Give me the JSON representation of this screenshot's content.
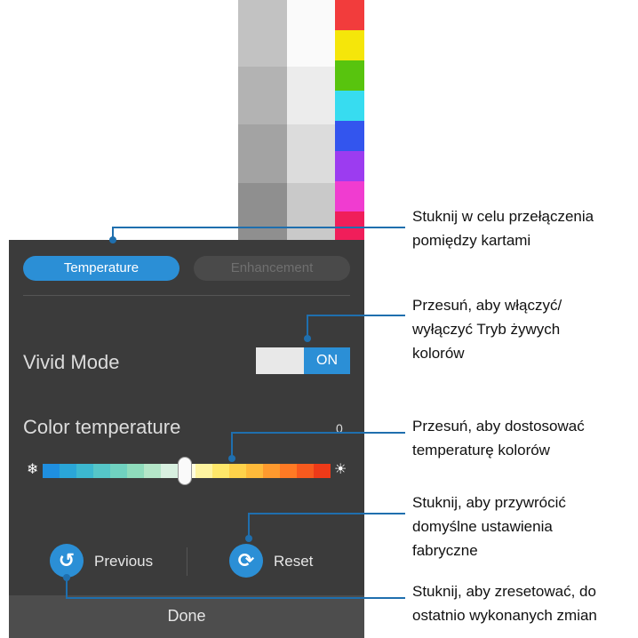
{
  "tabs": [
    {
      "label": "Temperature",
      "active": true
    },
    {
      "label": "Enhancement",
      "active": false
    }
  ],
  "vivid_mode": {
    "label": "Vivid Mode",
    "state": "ON"
  },
  "color_temperature": {
    "label": "Color temperature",
    "value": "0"
  },
  "buttons": {
    "previous": "Previous",
    "reset": "Reset",
    "done": "Done"
  },
  "callouts": {
    "tabs": "Stuknij w celu przełączenia\npomiędzy kartami",
    "toggle": "Przesuń, aby włączyć/\nwyłączyć Tryb żywych\nkolorów",
    "slider": "Przesuń, aby dostosować\ntemperaturę kolorów",
    "reset": "Stuknij, aby przywrócić\ndomyślne ustawienia\nfabryczne",
    "previous": "Stuknij, aby zresetować, do\nostatnio wykonanych zmian"
  },
  "colors": {
    "accent": "#2b8fd6",
    "panel": "#3b3b3b",
    "swatches": [
      "#f23c3c",
      "#f5e60a",
      "#58c40e",
      "#37dcf0",
      "#3355ee",
      "#9c3cf0",
      "#f03cd0",
      "#f01e5a"
    ]
  },
  "icons": [
    "snowflake-icon",
    "sun-icon",
    "undo-icon",
    "refresh-icon"
  ]
}
